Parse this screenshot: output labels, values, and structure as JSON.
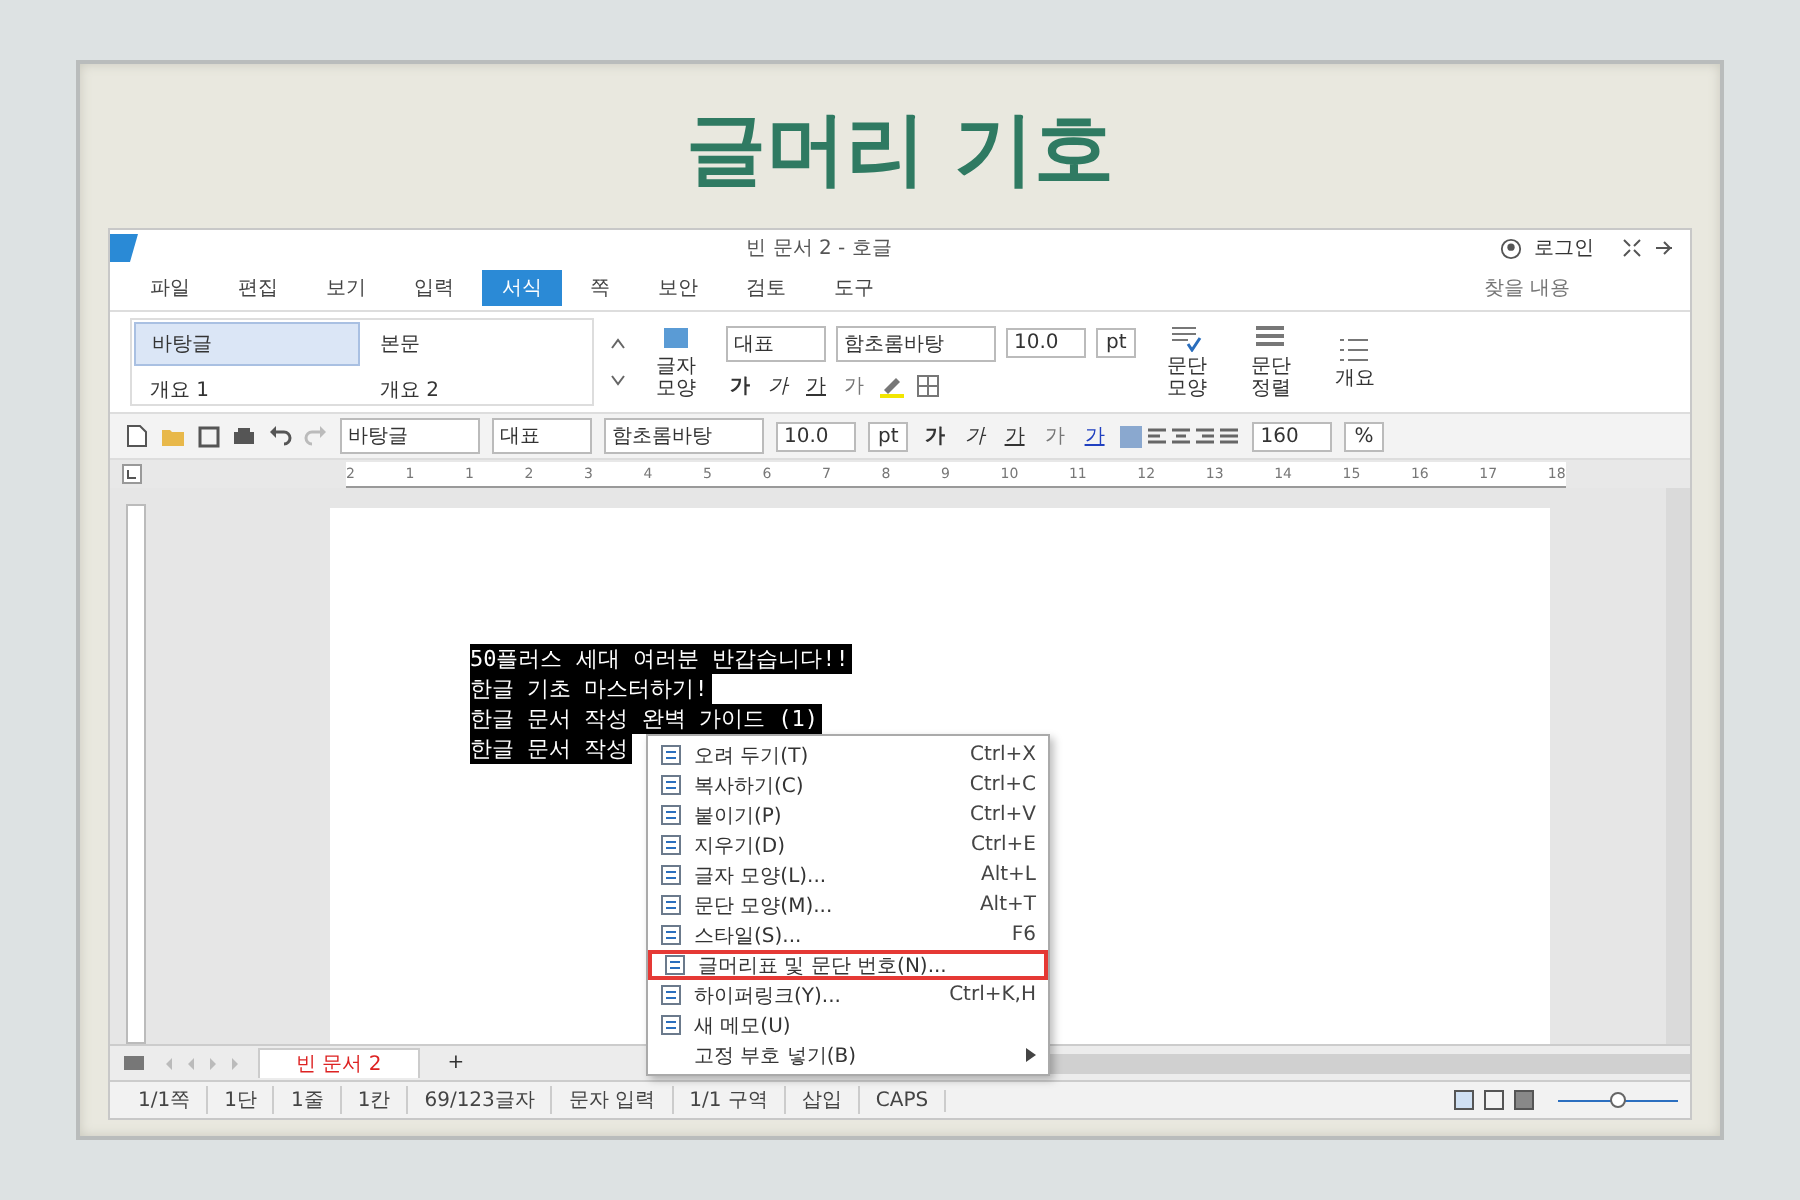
{
  "slide_title": "글머리 기호",
  "window": {
    "title": "빈 문서 2 - 호글",
    "login": "로그인",
    "search": {
      "placeholder": "찾을 내용"
    }
  },
  "menu_bar": [
    {
      "label": "파일",
      "selected": false
    },
    {
      "label": "편집",
      "selected": false
    },
    {
      "label": "보기",
      "selected": false
    },
    {
      "label": "입력",
      "selected": false
    },
    {
      "label": "서식",
      "selected": true
    },
    {
      "label": "쪽",
      "selected": false
    },
    {
      "label": "보안",
      "selected": false
    },
    {
      "label": "검토",
      "selected": false
    },
    {
      "label": "도구",
      "selected": false
    }
  ],
  "ribbon": {
    "styles": [
      {
        "label": "바탕글",
        "selected": true
      },
      {
        "label": "본문",
        "selected": false
      },
      {
        "label": "개요 1",
        "selected": false
      },
      {
        "label": "개요 2",
        "selected": false
      }
    ],
    "char_shape": "글자 모양",
    "font_group": "대표",
    "font": "함초롬바탕",
    "size": "10.0",
    "unit": "pt",
    "glyphs": [
      "가",
      "가",
      "가",
      "가"
    ],
    "para_shape": "문단 모양",
    "para_align": "문단 정렬",
    "outline": "개요"
  },
  "toolbar": {
    "style": "바탕글",
    "font_group": "대표",
    "font": "함초롬바탕",
    "size": "10.0",
    "unit": "pt",
    "glyphs": [
      "가",
      "가",
      "가",
      "가",
      "가"
    ],
    "zoom": "160",
    "zoom_unit": "%"
  },
  "ruler": [
    "2",
    "1",
    "1",
    "2",
    "3",
    "4",
    "5",
    "6",
    "7",
    "8",
    "9",
    "10",
    "11",
    "12",
    "13",
    "14",
    "15",
    "16",
    "17",
    "18"
  ],
  "document": {
    "lines": [
      {
        "text": "50플러스 세대 여러분 반갑습니다!!",
        "selected": true
      },
      {
        "text": "한글 기초 마스터하기!",
        "selected": true
      },
      {
        "text": "한글 문서 작성 완벽 가이드 (1)",
        "selected": true
      },
      {
        "text": "한글 문서 작성",
        "selected": true
      }
    ]
  },
  "context_menu": [
    {
      "label": "오려 두기(T)",
      "shortcut": "Ctrl+X",
      "selected": false,
      "kind": "item"
    },
    {
      "label": "복사하기(C)",
      "shortcut": "Ctrl+C",
      "selected": false,
      "kind": "item"
    },
    {
      "label": "붙이기(P)",
      "shortcut": "Ctrl+V",
      "selected": false,
      "kind": "item"
    },
    {
      "label": "지우기(D)",
      "shortcut": "Ctrl+E",
      "selected": false,
      "kind": "item"
    },
    {
      "label": "글자 모양(L)...",
      "shortcut": "Alt+L",
      "selected": false,
      "kind": "item"
    },
    {
      "label": "문단 모양(M)...",
      "shortcut": "Alt+T",
      "selected": false,
      "kind": "item"
    },
    {
      "label": "스타일(S)...",
      "shortcut": "F6",
      "selected": false,
      "kind": "item"
    },
    {
      "label": "글머리표 및 문단 번호(N)...",
      "selected": true,
      "kind": "item"
    },
    {
      "label": "하이퍼링크(Y)...",
      "shortcut": "Ctrl+K,H",
      "selected": false,
      "kind": "item"
    },
    {
      "label": "새 메모(U)",
      "selected": false,
      "kind": "item"
    },
    {
      "label": "고정 부호 넣기(B)",
      "selected": false,
      "kind": "submenu"
    }
  ],
  "doc_tabs": [
    {
      "label": "빈 문서 2",
      "selected": true
    }
  ],
  "add_tab": "+",
  "status_bar": [
    "1/1쪽",
    "1단",
    "1줄",
    "1칸",
    "69/123글자",
    "문자 입력",
    "1/1 구역",
    "삽입",
    "CAPS"
  ],
  "zoom_slider": {
    "level": 0.5
  }
}
